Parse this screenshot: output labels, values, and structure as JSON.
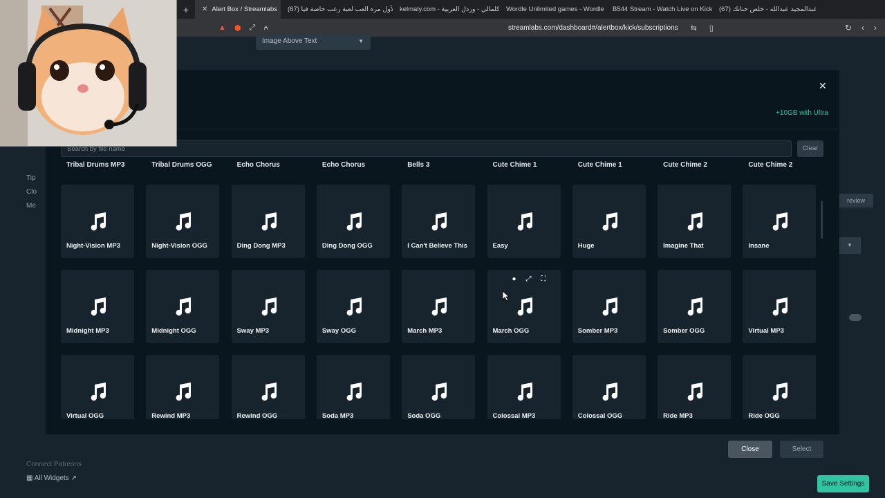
{
  "browser": {
    "tabs": [
      {
        "label": "Alert Box / Streamlabs",
        "active": true,
        "color": "#e8eaed"
      },
      {
        "label": "(67) لأول مره العب لعبة رعب خاصة فيا",
        "active": false,
        "color": "#ff0000"
      },
      {
        "label": "kelmaly.com - كلمالي - وردل العربية",
        "active": false,
        "color": "#10a37f"
      },
      {
        "label": "Wordle Unlimited games - Wordle Te",
        "active": false,
        "color": "#6aaa64"
      },
      {
        "label": "B544 Stream - Watch Live on Kick",
        "active": false,
        "color": "#53fc18"
      },
      {
        "label": "(67) عبدالمجيد عبدالله - خلص حنانك (-",
        "active": false,
        "color": "#ff0000"
      }
    ],
    "new_tab": "+",
    "url": "streamlabs.com/dashboard#/alertbox/kick/subscriptions"
  },
  "background": {
    "dropdown_value": "Image Above Text",
    "side_items": [
      "Tip",
      "Clo",
      "Me"
    ],
    "right_button": "review",
    "faded_item": "Connect Patreons",
    "all_widgets": "All Widgets",
    "save_settings": "Save Settings"
  },
  "modal": {
    "ultra_text": "+10GB with Ultra",
    "search_placeholder": "Search by file name",
    "clear_label": "Clear",
    "close_label": "Close",
    "select_label": "Select",
    "partial_top_labels": [
      "Tribal Drums MP3",
      "Tribal Drums OGG",
      "Echo Chorus",
      "Echo Chorus",
      "Bells 3",
      "Cute Chime 1",
      "Cute Chime 1",
      "Cute Chime 2",
      "Cute Chime 2"
    ],
    "rows": [
      [
        "Night-Vision MP3",
        "Night-Vision OGG",
        "Ding Dong MP3",
        "Ding Dong OGG",
        "I Can't Believe This",
        "Easy",
        "Huge",
        "Imagine That",
        "Insane"
      ],
      [
        "Midnight MP3",
        "Midnight OGG",
        "Sway MP3",
        "Sway OGG",
        "March MP3",
        "March OGG",
        "Somber MP3",
        "Somber OGG",
        "Virtual MP3"
      ],
      [
        "Virtual OGG",
        "Rewind MP3",
        "Rewind OGG",
        "Soda MP3",
        "Soda OGG",
        "Colossal MP3",
        "Colossal OGG",
        "Ride MP3",
        "Ride OGG"
      ]
    ],
    "hovered_tile": "March OGG",
    "icon": "music-note-icon",
    "accent_color": "#31c3a2"
  }
}
